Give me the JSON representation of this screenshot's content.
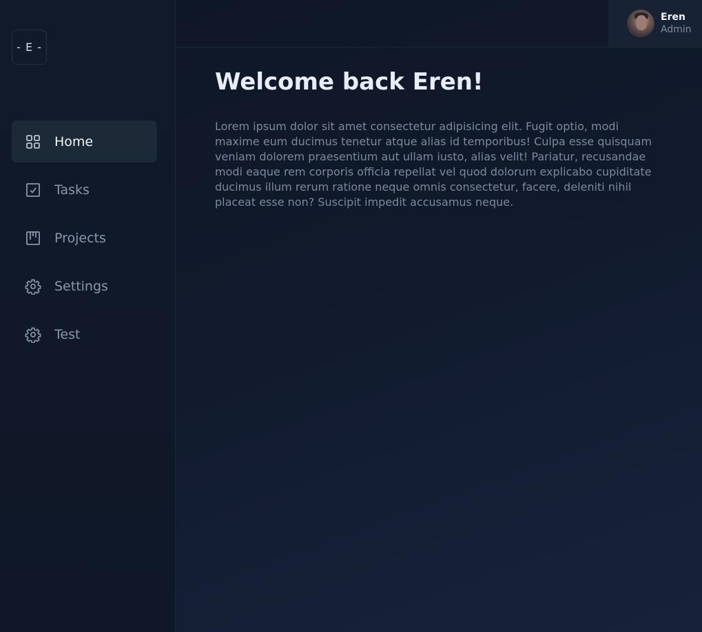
{
  "sidebar": {
    "logo": "- E -",
    "items": [
      {
        "label": "Home",
        "icon": "grid-icon",
        "active": true
      },
      {
        "label": "Tasks",
        "icon": "checkbox-icon",
        "active": false
      },
      {
        "label": "Projects",
        "icon": "kanban-icon",
        "active": false
      },
      {
        "label": "Settings",
        "icon": "gear-icon",
        "active": false
      },
      {
        "label": "Test",
        "icon": "gear-icon",
        "active": false
      }
    ]
  },
  "user": {
    "name": "Eren",
    "role": "Admin"
  },
  "main": {
    "title": "Welcome back Eren!",
    "paragraph": "Lorem ipsum dolor sit amet consectetur adipisicing elit. Fugit optio, modi maxime eum ducimus tenetur atque alias id temporibus! Culpa esse quisquam veniam dolorem praesentium aut ullam iusto, alias velit! Pariatur, recusandae modi eaque rem corporis officia repellat vel quod dolorum explicabo cupiditate ducimus illum rerum ratione neque omnis consectetur, facere, deleniti nihil placeat esse non? Suscipit impedit accusamus neque."
  },
  "colors": {
    "background": "#111a2c",
    "active_nav": "#1b2a36",
    "text_primary": "#f2f5f9",
    "text_muted": "#8a97ad"
  }
}
